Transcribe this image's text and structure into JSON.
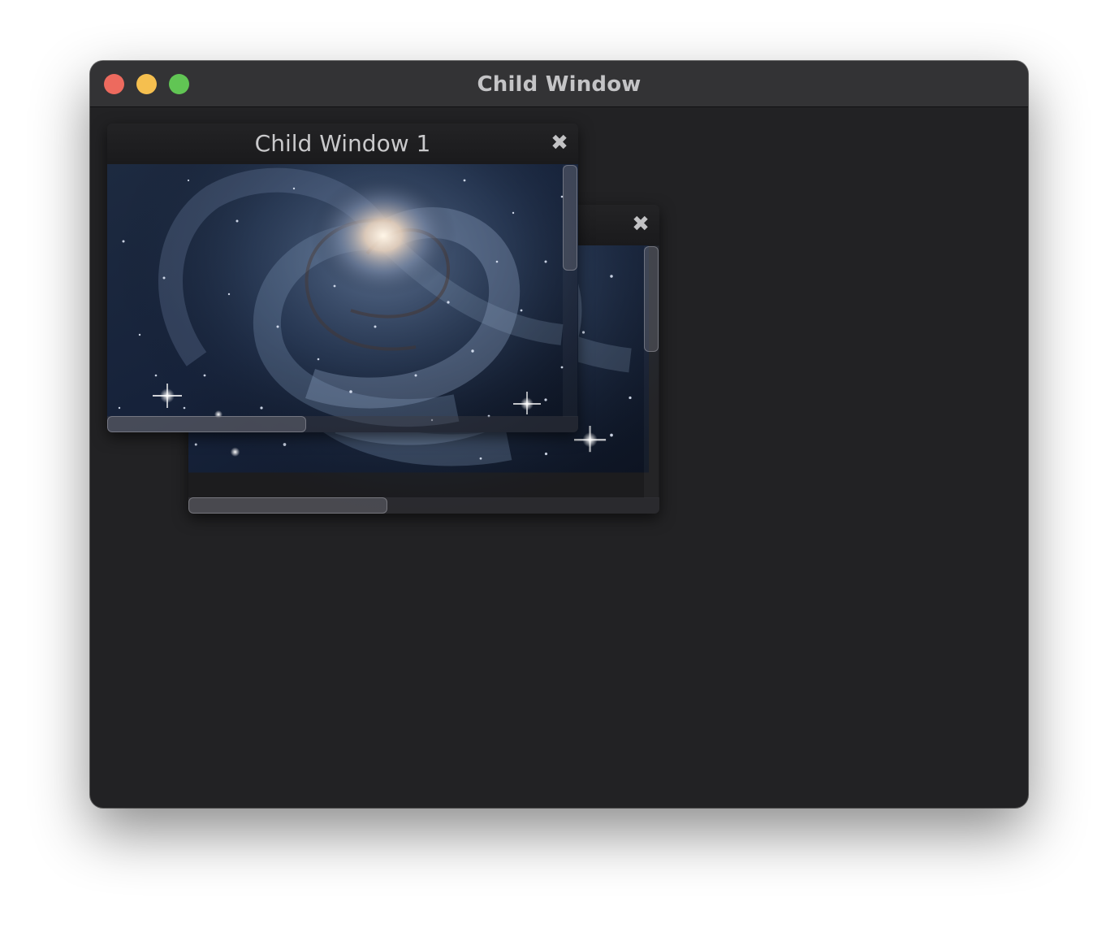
{
  "main_window": {
    "title": "Child Window",
    "controls": [
      "close",
      "minimize",
      "maximize"
    ]
  },
  "child_windows": [
    {
      "title": "",
      "close_glyph": "✖",
      "content_icon": "galaxy-image"
    },
    {
      "title": "Child Window 1",
      "close_glyph": "✖",
      "content_icon": "galaxy-image"
    }
  ],
  "colors": {
    "close_button": "#ed6a5e",
    "minimize_button": "#f5bf4f",
    "maximize_button": "#61c554",
    "window_background": "#222224",
    "titlebar": "#333335"
  }
}
